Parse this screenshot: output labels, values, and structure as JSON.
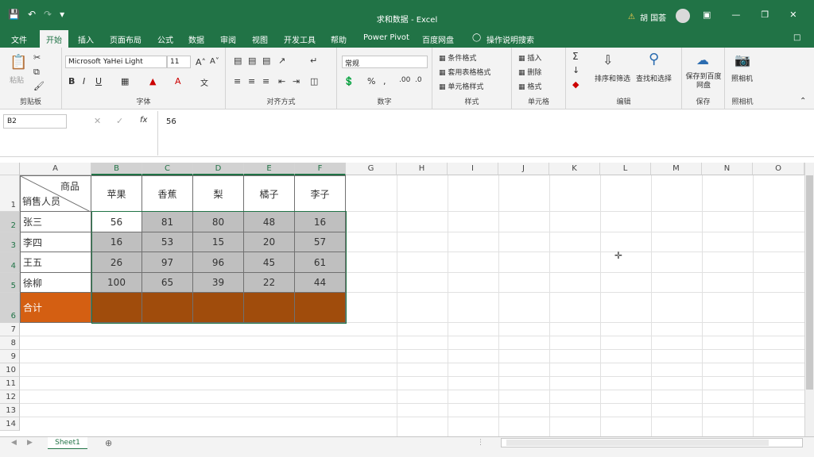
{
  "window": {
    "title": "求和数据 - Excel",
    "user": "胡 国荟"
  },
  "tabs": [
    "文件",
    "开始",
    "插入",
    "页面布局",
    "公式",
    "数据",
    "审阅",
    "视图",
    "开发工具",
    "帮助",
    "Power Pivot",
    "百度网盘",
    "操作说明搜索"
  ],
  "ribbon": {
    "clipboard": {
      "paste": "粘贴",
      "label": "剪贴板"
    },
    "font": {
      "name": "Microsoft YaHei Light",
      "size": "11",
      "label": "字体"
    },
    "alignment": {
      "label": "对齐方式"
    },
    "number": {
      "format": "常规",
      "label": "数字"
    },
    "styles": {
      "cond": "条件格式",
      "table": "套用表格格式",
      "cell": "单元格样式",
      "label": "样式"
    },
    "cells": {
      "insert": "插入",
      "delete": "删除",
      "format": "格式",
      "label": "单元格"
    },
    "editing": {
      "sort": "排序和筛选",
      "find": "查找和选择",
      "label": "编辑"
    },
    "save": {
      "btn": "保存到百度网盘",
      "label": "保存"
    },
    "camera": {
      "btn": "照相机",
      "label": "照相机"
    }
  },
  "formula": {
    "namebox": "B2",
    "value": "56"
  },
  "columns": [
    "A",
    "B",
    "C",
    "D",
    "E",
    "F",
    "G",
    "H",
    "I",
    "J",
    "K",
    "L",
    "M",
    "N",
    "O"
  ],
  "rows": [
    "1",
    "2",
    "3",
    "4",
    "5",
    "6",
    "7",
    "8",
    "9",
    "10",
    "11",
    "12",
    "13",
    "14"
  ],
  "table": {
    "corner_top": "商品",
    "corner_bottom": "销售人员",
    "headers": [
      "苹果",
      "香蕉",
      "梨",
      "橘子",
      "李子"
    ],
    "people": [
      "张三",
      "李四",
      "王五",
      "徐柳"
    ],
    "values": [
      [
        "56",
        "81",
        "80",
        "48",
        "16"
      ],
      [
        "16",
        "53",
        "15",
        "20",
        "57"
      ],
      [
        "26",
        "97",
        "96",
        "45",
        "61"
      ],
      [
        "100",
        "65",
        "39",
        "22",
        "44"
      ]
    ],
    "total_label": "合计"
  },
  "sheet": {
    "tab": "Sheet1"
  }
}
